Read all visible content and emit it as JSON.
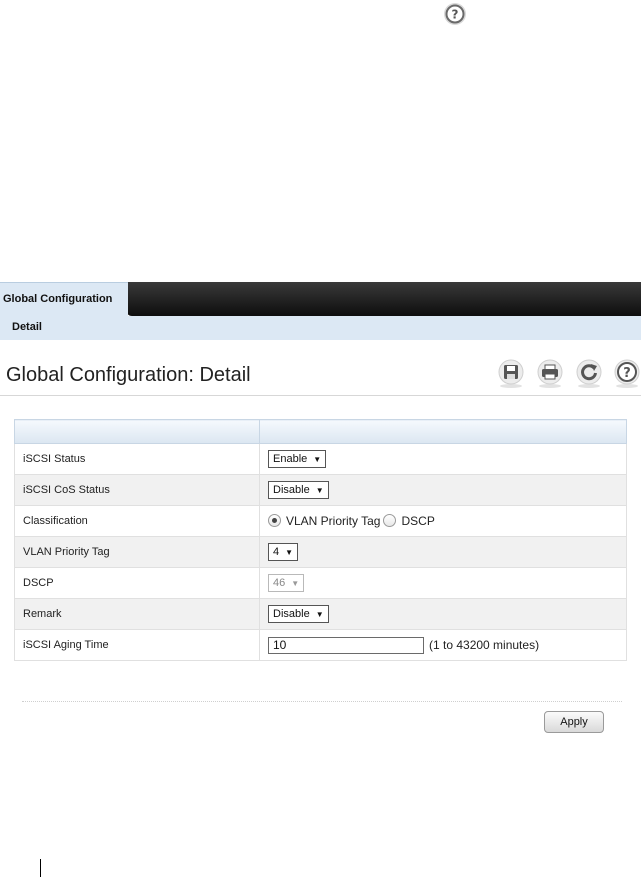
{
  "page_help_icon": "help-icon",
  "tabs": {
    "active_label": "Global Configuration",
    "sub_label": "Detail"
  },
  "header": {
    "title": "Global Configuration: Detail",
    "tools": [
      "save-icon",
      "print-icon",
      "refresh-icon",
      "help-icon"
    ]
  },
  "form": {
    "iscsi_status": {
      "label": "iSCSI Status",
      "value": "Enable"
    },
    "cos_status": {
      "label": "iSCSI CoS Status",
      "value": "Disable"
    },
    "classification": {
      "label": "Classification",
      "options": [
        "VLAN Priority Tag",
        "DSCP"
      ],
      "selected": "VLAN Priority Tag"
    },
    "vlan_priority_tag": {
      "label": "VLAN Priority Tag",
      "value": "4"
    },
    "dscp": {
      "label": "DSCP",
      "value": "46"
    },
    "remark": {
      "label": "Remark",
      "value": "Disable"
    },
    "aging_time": {
      "label": "iSCSI Aging Time",
      "value": "10",
      "hint": "(1 to 43200 minutes)"
    }
  },
  "footer": {
    "apply_label": "Apply"
  },
  "colors": {
    "tab_bg": "#dce8f4",
    "dark_bar": "#1a1a1a",
    "alt_row": "#f1f1f1",
    "icon_gray": "#5a5a5a"
  }
}
